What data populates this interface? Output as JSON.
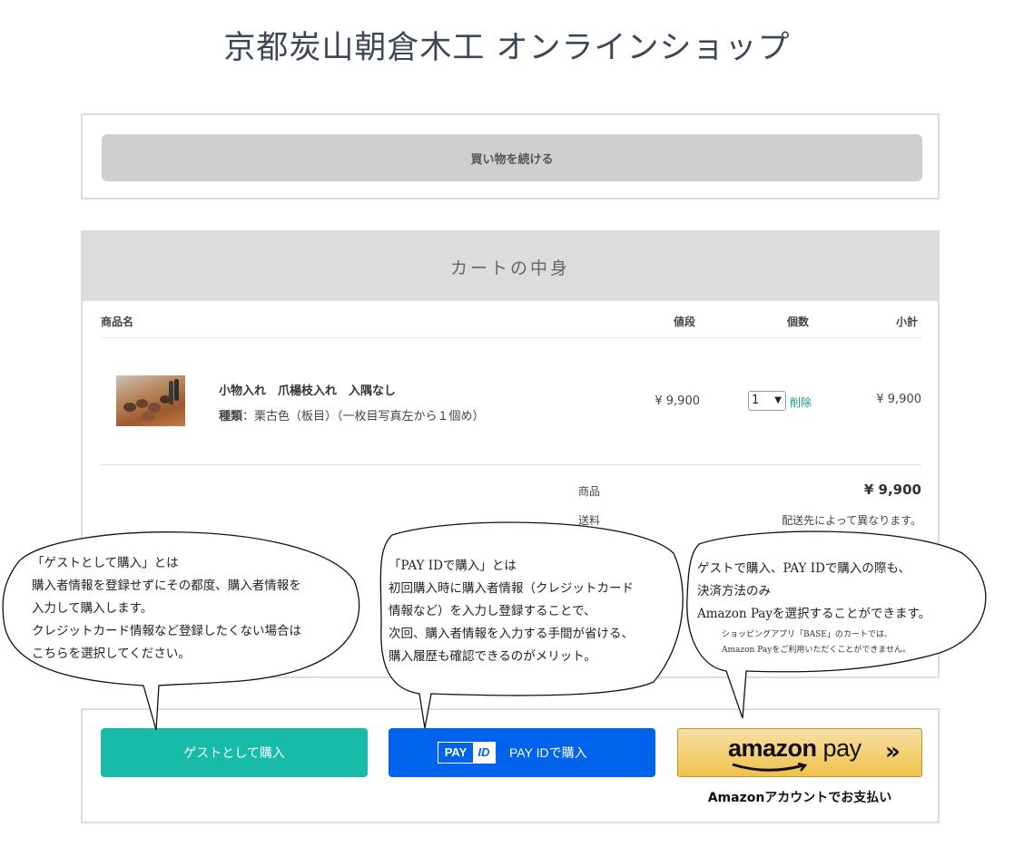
{
  "header": {
    "title": "京都炭山朝倉木工 オンラインショップ"
  },
  "continue": {
    "label": "買い物を続ける"
  },
  "cart": {
    "title": "カートの中身",
    "columns": {
      "name": "商品名",
      "price": "値段",
      "qty": "個数",
      "subtotal": "小計"
    },
    "item": {
      "name": "小物入れ　爪楊枝入れ　入隅なし",
      "variant_label": "種類",
      "variant_value": "：栗古色（板目）（一枚目写真左から１個め）",
      "price": "¥ 9,900",
      "qty": "1",
      "delete": "削除",
      "subtotal": "¥ 9,900"
    },
    "summary": {
      "goods_label": "商品",
      "goods_value": "¥ 9,900",
      "shipping_label": "送料",
      "shipping_value": "配送先によって異なります。"
    }
  },
  "payment": {
    "guest_label": "ゲストとして購入",
    "payid_logo_pay": "PAY",
    "payid_logo_id": "ID",
    "payid_label": "PAY IDで購入",
    "amazon_logo_word": "amazon",
    "amazon_logo_pay": "pay",
    "amazon_chevrons": "»",
    "amazon_caption": "Amazonアカウントでお支払い"
  },
  "bubbles": {
    "guest": {
      "lines": [
        "「ゲストとして購入」とは",
        "購入者情報を登録せずにその都度、購入者情報を",
        "入力して購入します。",
        "クレジットカード情報など登録したくない場合は",
        "こちらを選択してください。"
      ]
    },
    "payid": {
      "lines": [
        "「PAY IDで購入」とは",
        "初回購入時に購入者情報（クレジットカード",
        "情報など）を入力し登録することで、",
        "次回、購入者情報を入力する手間が省ける、",
        "購入履歴も確認できるのがメリット。"
      ]
    },
    "amazon": {
      "lines": [
        "ゲストで購入、PAY IDで購入の際も、",
        "決済方法のみ",
        "Amazon Payを選択することができます。"
      ],
      "notes": [
        "ショッピングアプリ「BASE」のカートでは、",
        "Amazon Payをご利用いただくことができません。"
      ]
    }
  },
  "colors": {
    "guest_button": "#17bba8",
    "payid_button": "#0063eb",
    "amazon_button": "#f0c14b",
    "delete_link": "#169a8d"
  }
}
